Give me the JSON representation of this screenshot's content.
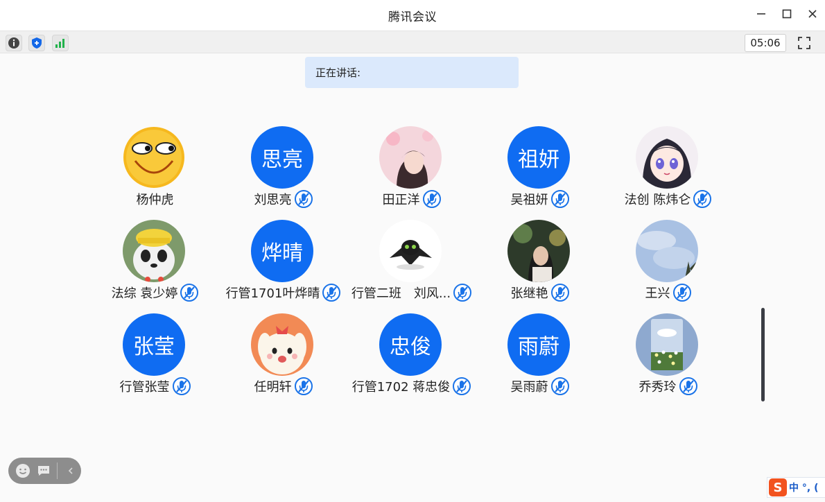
{
  "window": {
    "title": "腾讯会议"
  },
  "toolbar": {
    "timer": "05:06"
  },
  "speaking": {
    "label": "正在讲话:"
  },
  "colors": {
    "accent": "#0f6cf2",
    "speaking_bg": "#dbe9fc",
    "mic_muted": "#1a73e8"
  },
  "participants": [
    {
      "name": "杨仲虎",
      "avatar_text": "",
      "avatar_icon": "laughing-emoji-avatar",
      "mic_icon": false
    },
    {
      "name": "刘思亮",
      "avatar_text": "思亮",
      "avatar_icon": "",
      "mic_icon": true
    },
    {
      "name": "田正洋",
      "avatar_text": "",
      "avatar_icon": "anime-girl-cherry-blossom-avatar",
      "mic_icon": true
    },
    {
      "name": "吴祖妍",
      "avatar_text": "祖妍",
      "avatar_icon": "",
      "mic_icon": true
    },
    {
      "name": "法创 陈炜仑",
      "avatar_text": "",
      "avatar_icon": "anime-girl-avatar",
      "mic_icon": true
    },
    {
      "name": "法综 袁少婷",
      "avatar_text": "",
      "avatar_icon": "panda-hat-avatar",
      "mic_icon": true
    },
    {
      "name": "行管1701叶烨晴",
      "avatar_text": "烨晴",
      "avatar_icon": "",
      "mic_icon": true
    },
    {
      "name": "行管二班　刘风...",
      "avatar_text": "",
      "avatar_icon": "black-dragon-avatar",
      "mic_icon": true
    },
    {
      "name": "张继艳",
      "avatar_text": "",
      "avatar_icon": "girl-photo-avatar",
      "mic_icon": true
    },
    {
      "name": "王兴",
      "avatar_text": "",
      "avatar_icon": "sky-photo-avatar",
      "mic_icon": true
    },
    {
      "name": "行管张莹",
      "avatar_text": "张莹",
      "avatar_icon": "",
      "mic_icon": true
    },
    {
      "name": "任明轩",
      "avatar_text": "",
      "avatar_icon": "cartoon-bunny-avatar",
      "mic_icon": true
    },
    {
      "name": "行管1702 蒋忠俊",
      "avatar_text": "忠俊",
      "avatar_icon": "",
      "mic_icon": true
    },
    {
      "name": "吴雨蔚",
      "avatar_text": "雨蔚",
      "avatar_icon": "",
      "mic_icon": true
    },
    {
      "name": "乔秀玲",
      "avatar_text": "",
      "avatar_icon": "flowers-photo-avatar",
      "mic_icon": true
    }
  ],
  "ime": {
    "logo": "S",
    "text": "中 °, ("
  }
}
